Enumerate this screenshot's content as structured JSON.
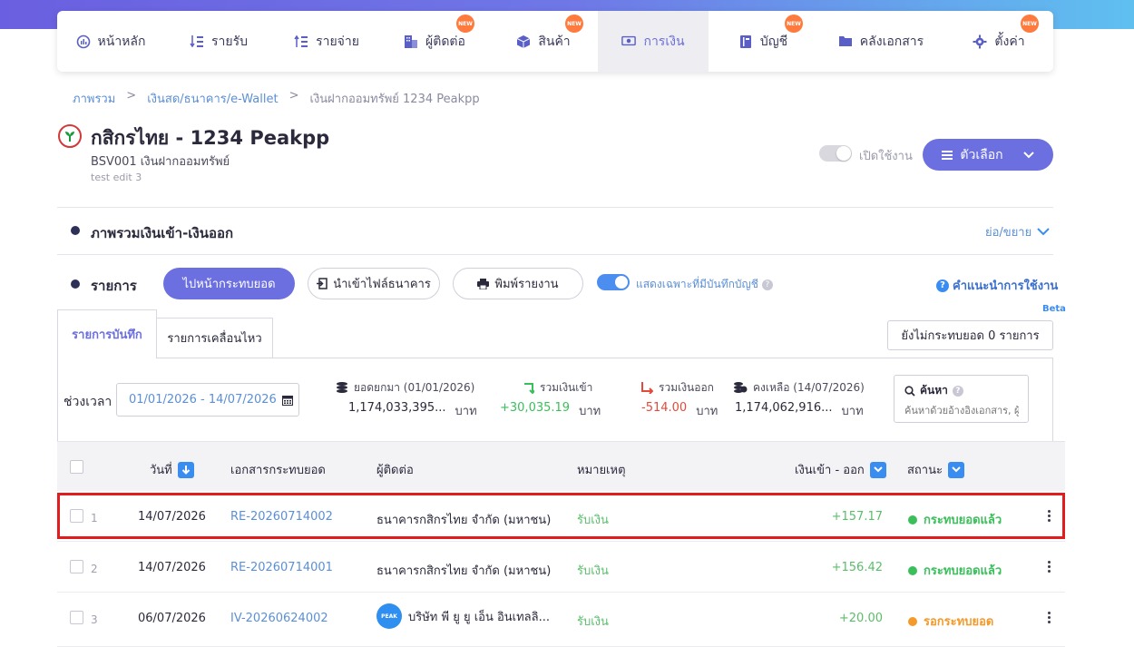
{
  "nav": {
    "items": [
      {
        "label": "หน้าหลัก",
        "icon": "dashboard-icon",
        "new": false,
        "active": false
      },
      {
        "label": "รายรับ",
        "icon": "income-list-icon",
        "new": false,
        "active": false
      },
      {
        "label": "รายจ่าย",
        "icon": "expense-list-icon",
        "new": false,
        "active": false
      },
      {
        "label": "ผู้ติดต่อ",
        "icon": "contacts-icon",
        "new": true,
        "active": false
      },
      {
        "label": "สินค้า",
        "icon": "product-box-icon",
        "new": true,
        "active": false
      },
      {
        "label": "การเงิน",
        "icon": "money-icon",
        "new": false,
        "active": true
      },
      {
        "label": "บัญชี",
        "icon": "ledger-book-icon",
        "new": true,
        "active": false
      },
      {
        "label": "คลังเอกสาร",
        "icon": "folder-icon",
        "new": false,
        "active": false
      },
      {
        "label": "ตั้งค่า",
        "icon": "gear-icon",
        "new": true,
        "active": false
      }
    ],
    "new_badge": "NEW"
  },
  "breadcrumb": {
    "items": [
      "ภาพรวม",
      "เงินสด/ธนาคาร/e-Wallet",
      "เงินฝากออมทรัพย์ 1234 Peakpp"
    ],
    "separator": ">"
  },
  "header": {
    "title": "กสิกรไทย - 1234 Peakpp",
    "code_line": "BSV001 เงินฝากออมทรัพย์",
    "note_line": "test edit 3",
    "toggle_label": "เปิดใช้งาน",
    "options_label": "ตัวเลือก"
  },
  "overview": {
    "title": "ภาพรวมเงินเข้า-เงินออก",
    "collapse_label": "ย่อ/ขยาย"
  },
  "list": {
    "title": "รายการ",
    "go_reconcile": "ไปหน้ากระทบยอด",
    "import_bank_file": "นำเข้าไฟล์ธนาคาร",
    "print_report": "พิมพ์รายงาน",
    "show_only_recorded": "แสดงเฉพาะที่มีบันทึกบัญชี",
    "guide": "คำแนะนำการใช้งาน",
    "beta": "Beta",
    "unreconciled": "ยังไม่กระทบยอด 0 รายการ"
  },
  "tabs": [
    {
      "label": "รายการบันทึก",
      "active": true
    },
    {
      "label": "รายการเคลื่อนไหว",
      "active": false
    }
  ],
  "filter": {
    "period_label": "ช่วงเวลา",
    "date_range": "01/01/2026 - 14/07/2026"
  },
  "stats": {
    "opening": {
      "label": "ยอดยกมา (01/01/2026)",
      "value": "1,174,033,395...",
      "unit": "บาท"
    },
    "total_in": {
      "label": "รวมเงินเข้า",
      "value": "+30,035.19",
      "unit": "บาท"
    },
    "total_out": {
      "label": "รวมเงินออก",
      "value": "-514.00",
      "unit": "บาท"
    },
    "balance": {
      "label": "คงเหลือ (14/07/2026)",
      "value": "1,174,062,916...",
      "unit": "บาท"
    }
  },
  "search": {
    "label": "ค้นหา",
    "placeholder": "ค้นหาด้วยอ้างอิงเอกสาร, ผู้ติดต่อ"
  },
  "table": {
    "headers": {
      "date": "วันที่",
      "document": "เอกสารกระทบยอด",
      "contact": "ผู้ติดต่อ",
      "note": "หมายเหตุ",
      "amount": "เงินเข้า - ออก",
      "status": "สถานะ"
    },
    "rows": [
      {
        "num": "1",
        "date": "14/07/2026",
        "document": "RE-20260714002",
        "contact": "ธนาคารกสิกรไทย จำกัด (มหาชน)",
        "avatar": "",
        "note": "รับเงิน",
        "amount": "+157.17",
        "status": "กระทบยอดแล้ว",
        "status_color": "#3bbf5b"
      },
      {
        "num": "2",
        "date": "14/07/2026",
        "document": "RE-20260714001",
        "contact": "ธนาคารกสิกรไทย จำกัด (มหาชน)",
        "avatar": "",
        "note": "รับเงิน",
        "amount": "+156.42",
        "status": "กระทบยอดแล้ว",
        "status_color": "#3bbf5b"
      },
      {
        "num": "3",
        "date": "06/07/2026",
        "document": "IV-20260624002",
        "contact": "บริษัท พี ยู ยู เอ็น อินเทลลิ...",
        "avatar": "PEAK",
        "note": "รับเงิน",
        "amount": "+20.00",
        "status": "รอกระทบยอด",
        "status_color": "#f39a2b"
      }
    ]
  },
  "colors": {
    "primary": "#6c6fe0",
    "link": "#5b8fd6",
    "positive": "#5bbd6a",
    "negative": "#e24a3a",
    "highlight": "#e21c1c"
  }
}
